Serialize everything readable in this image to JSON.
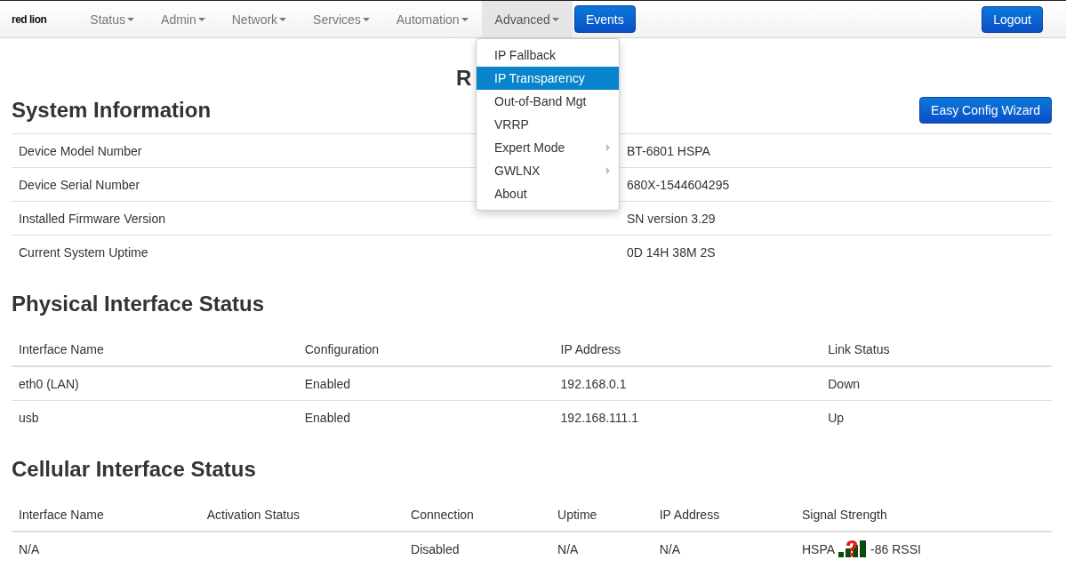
{
  "navbar": {
    "logo": "red lion",
    "items": [
      {
        "label": "Status",
        "selected": false
      },
      {
        "label": "Admin",
        "selected": false
      },
      {
        "label": "Network",
        "selected": false
      },
      {
        "label": "Services",
        "selected": false
      },
      {
        "label": "Automation",
        "selected": false
      },
      {
        "label": "Advanced",
        "selected": true
      }
    ],
    "events_button": "Events",
    "logout_button": "Logout",
    "dropdown": [
      {
        "label": "IP Fallback",
        "selected": false,
        "submenu": false
      },
      {
        "label": "IP Transparency",
        "selected": true,
        "submenu": false
      },
      {
        "label": "Out-of-Band Mgt",
        "selected": false,
        "submenu": false
      },
      {
        "label": "VRRP",
        "selected": false,
        "submenu": false
      },
      {
        "label": "Expert Mode",
        "selected": false,
        "submenu": true
      },
      {
        "label": "GWLNX",
        "selected": false,
        "submenu": true
      },
      {
        "label": "About",
        "selected": false,
        "submenu": false
      }
    ]
  },
  "page_title": "R",
  "system_information": {
    "title": "System Information",
    "wizard_button": "Easy Config Wizard",
    "rows": [
      [
        "Device Model Number",
        "BT-6801 HSPA"
      ],
      [
        "Device Serial Number",
        "680X-1544604295"
      ],
      [
        "Installed Firmware Version",
        "SN version 3.29"
      ],
      [
        "Current System Uptime",
        "0D 14H 38M 2S"
      ]
    ]
  },
  "physical_interface_status": {
    "title": "Physical Interface Status",
    "columns": [
      "Interface Name",
      "Configuration",
      "IP Address",
      "Link Status"
    ],
    "rows": [
      [
        "eth0 (LAN)",
        "Enabled",
        "192.168.0.1",
        "Down"
      ],
      [
        "usb",
        "Enabled",
        "192.168.111.1",
        "Up"
      ]
    ]
  },
  "cellular_interface_status": {
    "title": "Cellular Interface Status",
    "columns": [
      "Interface Name",
      "Activation Status",
      "Connection",
      "Uptime",
      "IP Address",
      "Signal Strength"
    ],
    "rows": [
      {
        "interface_name": "N/A",
        "activation_status": "",
        "connection": "Disabled",
        "uptime": "N/A",
        "ip_address": "N/A",
        "signal_type": "HSPA",
        "signal_reading": "-86 RSSI"
      }
    ]
  }
}
